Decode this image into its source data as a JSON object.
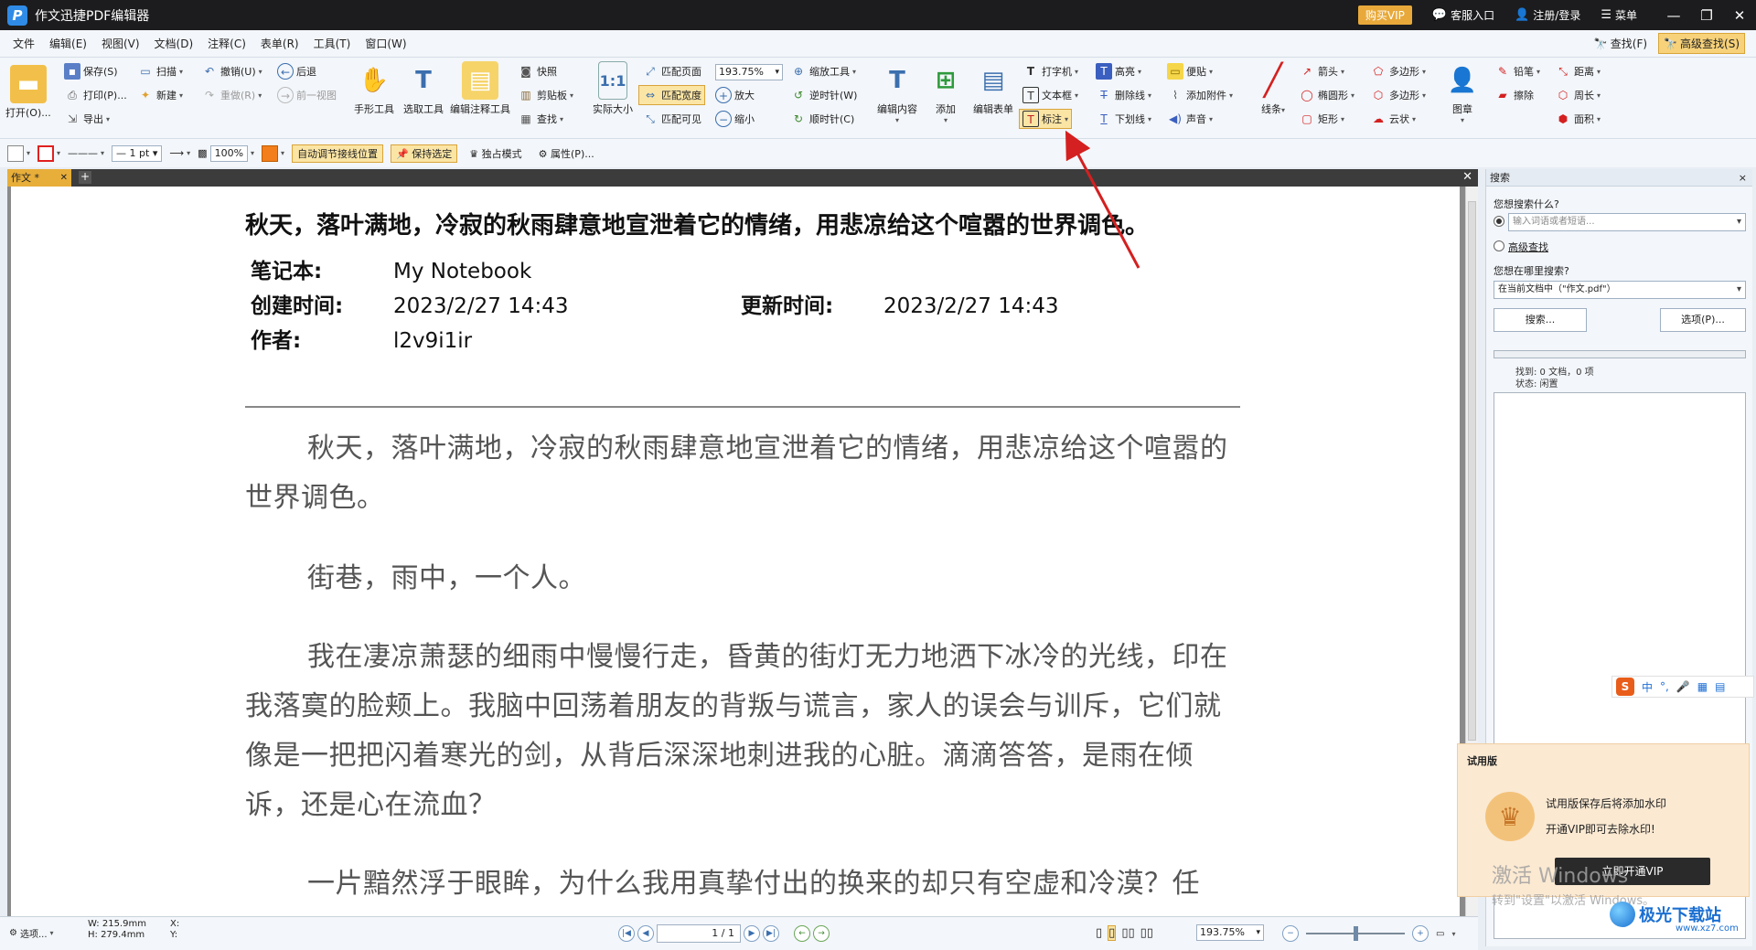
{
  "app": {
    "logo": "P",
    "title": "作文迅捷PDF编辑器"
  },
  "titlebar": {
    "vip": "购买VIP",
    "service": "客服入口",
    "login": "注册/登录",
    "menu": "菜单",
    "minimize": "—",
    "restore": "❐",
    "close": "✕"
  },
  "menubar": {
    "items": [
      "文件",
      "编辑(E)",
      "视图(V)",
      "文档(D)",
      "注释(C)",
      "表单(R)",
      "工具(T)",
      "窗口(W)"
    ],
    "find": "查找(F)",
    "advanced_find": "高级查找(S)"
  },
  "ribbon": {
    "open": "打开(O)...",
    "save": "保存(S)",
    "print": "打印(P)...",
    "export": "导出",
    "scan": "扫描",
    "new": "新建",
    "undo": "撤销(U)",
    "redo": "重做(R)",
    "back": "后退",
    "prev_view": "前一视图",
    "hand_tool": "手形工具",
    "select_tool": "选取工具",
    "edit_annot_tool": "编辑注释工具",
    "snapshot": "快照",
    "clipboard": "剪贴板",
    "find": "查找",
    "actual_size": "实际大小",
    "fit_page": "匹配页面",
    "fit_width": "匹配宽度",
    "fit_visible": "匹配可见",
    "zoom_value": "193.75%",
    "zoom_in": "放大",
    "zoom_out": "缩小",
    "zoom_tool": "缩放工具",
    "rotate_ccw": "逆时针(W)",
    "rotate_cw": "顺时针(C)",
    "edit_content": "编辑内容",
    "add": "添加",
    "edit_form": "编辑表单",
    "typewriter": "打字机",
    "textbox": "文本框",
    "callout": "标注",
    "highlight": "高亮",
    "strikeout": "删除线",
    "underline": "下划线",
    "note": "便贴",
    "attach": "添加附件",
    "sound": "声音",
    "line": "线条",
    "arrow": "箭头",
    "ellipse": "椭圆形",
    "rect": "矩形",
    "polygon1": "多边形",
    "polygon2": "多边形",
    "cloud": "云状",
    "stamp": "图章",
    "pencil": "铅笔",
    "eraser": "擦除",
    "distance": "距离",
    "perimeter": "周长",
    "area": "面积"
  },
  "propbar": {
    "stroke_width": "1 pt",
    "opacity": "100%",
    "auto_adjust": "自动调节接线位置",
    "keep_selected": "保持选定",
    "exclusive": "独占模式",
    "properties": "属性(P)..."
  },
  "tabs": {
    "doc_tab": "作文 *",
    "add": "+",
    "close": "✕"
  },
  "document": {
    "title": "秋天，落叶满地，冷寂的秋雨肆意地宣泄着它的情绪，用悲凉给这个喧嚣的世界调色。",
    "notebook_label": "笔记本:",
    "notebook_value": "My Notebook",
    "created_label": "创建时间:",
    "created_value": "2023/2/27 14:43",
    "updated_label": "更新时间:",
    "updated_value": "2023/2/27 14:43",
    "author_label": "作者:",
    "author_value": "l2v9i1ir",
    "paragraphs": [
      "秋天，落叶满地，冷寂的秋雨肆意地宣泄着它的情绪，用悲凉给这个喧嚣的世界调色。",
      "街巷，雨中，一个人。",
      "我在凄凉萧瑟的细雨中慢慢行走，昏黄的街灯无力地洒下冰冷的光线，印在我落寞的脸颊上。我脑中回荡着朋友的背叛与谎言，家人的误会与训斥，它们就像是一把把闪着寒光的剑，从背后深深地刺进我的心脏。滴滴答答，是雨在倾诉，还是心在流血？",
      "一片黯然浮于眼眸，为什么我用真挚付出的换来的却只有空虚和冷漠？任"
    ]
  },
  "search": {
    "header": "搜索",
    "close": "×",
    "question": "您想搜索什么?",
    "input_placeholder": "输入词语或者短语...",
    "advanced": "高级查找",
    "where": "您想在哪里搜索?",
    "where_value": "在当前文档中（\"作文.pdf\"）",
    "search_btn": "搜索...",
    "options_btn": "选项(P)...",
    "found": "找到: 0 文档，0 项",
    "status": "状态: 闲置"
  },
  "ime": {
    "logo": "S",
    "mode": "中",
    "punct": "°,",
    "mic": "🎤",
    "kbd": "▦",
    "grid": "▤"
  },
  "trial": {
    "title": "试用版",
    "line1": "试用版保存后将添加水印",
    "line2": "开通VIP即可去除水印!",
    "button": "立即开通VIP",
    "badge": "VIP"
  },
  "watermark": {
    "line1": "激活 Windows",
    "line2": "转到\"设置\"以激活 Windows。"
  },
  "statusbar": {
    "options": "选项...",
    "width": "W: 215.9mm",
    "height": "H: 279.4mm",
    "x": "X:",
    "y": "Y:",
    "page": "1 / 1",
    "zoom": "193.75%"
  },
  "site": {
    "name": "极光下载站",
    "url": "www.xz7.com"
  },
  "colors": {
    "accent": "#e7ae3a",
    "titlebar": "#1c1c1e",
    "annotation_arrow": "#d42020"
  }
}
